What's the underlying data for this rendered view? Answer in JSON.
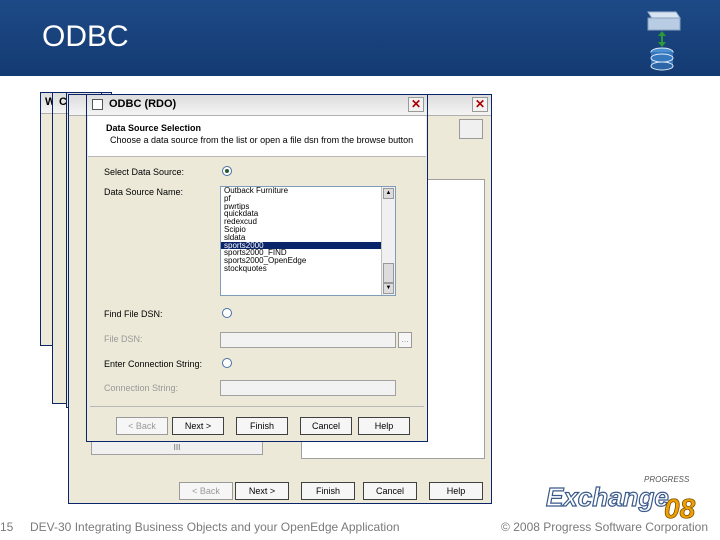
{
  "slide": {
    "title": "ODBC",
    "slide_number": "15",
    "footer_text": "DEV-30 Integrating Business Objects and your OpenEdge Application",
    "copyright": "© 2008 Progress Software Corporation",
    "brand_top": "PROGRESS",
    "brand_main": "Exchange",
    "brand_year": "08"
  },
  "back_windows": [
    {
      "title": "W"
    },
    {
      "title": "Cr"
    },
    {
      "title": ""
    }
  ],
  "back_wizard": {
    "buttons": {
      "back": "< Back",
      "next": "Next >",
      "finish": "Finish",
      "cancel": "Cancel",
      "help": "Help"
    },
    "scroll_mid": "III"
  },
  "dialog": {
    "title": "ODBC (RDO)",
    "heading": "Data Source Selection",
    "subheading": "Choose a data source from the list or open a file dsn from the browse button",
    "select_source_label": "Select Data Source:",
    "data_source_name_label": "Data Source Name:",
    "data_sources": [
      "Outback Furniture",
      "pf",
      "pwrtips",
      "quickdata",
      "redexcud",
      "Scipio",
      "sldata",
      "sports2000",
      "sports2000_FIND",
      "sports2000_OpenEdge",
      "stockquotes"
    ],
    "selected_index": 7,
    "find_file_dsn_label": "Find File DSN:",
    "file_dsn_label": "File DSN:",
    "browse_label": "...",
    "enter_connection_label": "Enter Connection String:",
    "connection_string_label": "Connection String:",
    "buttons": {
      "back": "< Back",
      "next": "Next >",
      "finish": "Finish",
      "cancel": "Cancel",
      "help": "Help"
    }
  }
}
